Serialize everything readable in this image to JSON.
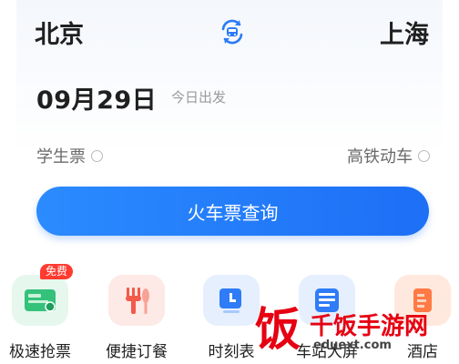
{
  "route": {
    "from": "北京",
    "to": "上海",
    "swap_icon": "train-swap-icon"
  },
  "date": {
    "value": "09月29日",
    "hint": "今日出发"
  },
  "options": {
    "student_ticket": "学生票",
    "gaotie_dongche": "高铁动车"
  },
  "search_button": "火车票查询",
  "services": [
    {
      "label": "极速抢票",
      "icon": "ticket-icon",
      "badge": "免费",
      "color": "#2fbf71"
    },
    {
      "label": "便捷订餐",
      "icon": "fork-icon",
      "color": "#f25a4a"
    },
    {
      "label": "时刻表",
      "icon": "schedule-icon",
      "color": "#2f7cf6"
    },
    {
      "label": "车站大屏",
      "icon": "board-icon",
      "color": "#2f7cf6"
    },
    {
      "label": "酒店",
      "icon": "hotel-icon",
      "color": "#ff7a45"
    }
  ],
  "watermark": {
    "logo_char": "饭",
    "name": "千饭手游网",
    "domain": "eduext.com"
  }
}
